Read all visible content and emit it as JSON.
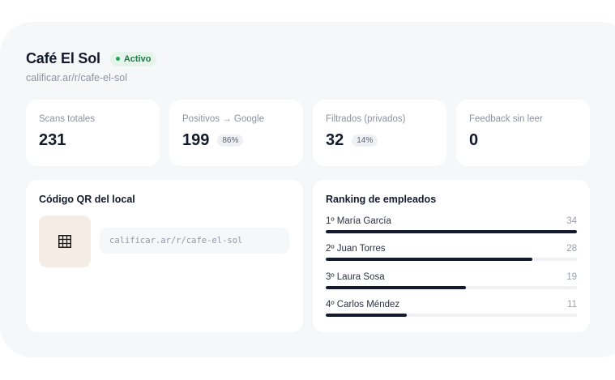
{
  "business": {
    "name": "Café El Sol",
    "status": "Activo",
    "url": "calificar.ar/r/cafe-el-sol"
  },
  "stats": [
    {
      "label": "Scans totales",
      "value": "231",
      "pct": ""
    },
    {
      "label": "Positivos → Google",
      "value": "199",
      "pct": "86%"
    },
    {
      "label": "Filtrados (privados)",
      "value": "32",
      "pct": "14%"
    },
    {
      "label": "Feedback sin leer",
      "value": "0",
      "pct": ""
    }
  ],
  "qr_card": {
    "title": "Código QR del local",
    "url": "calificar.ar/r/cafe-el-sol",
    "icon": "qr-code-icon"
  },
  "ranking": {
    "title": "Ranking de empleados",
    "max": 34,
    "items": [
      {
        "name": "1º María García",
        "score": 34
      },
      {
        "name": "2º Juan Torres",
        "score": 28
      },
      {
        "name": "3º Laura Sosa",
        "score": 19
      },
      {
        "name": "4º Carlos Méndez",
        "score": 11
      }
    ]
  },
  "colors": {
    "accent": "#141a2e",
    "status_green": "#22a55a",
    "panel_bg": "#f6f7f9",
    "qr_bg": "#f5ece6"
  }
}
